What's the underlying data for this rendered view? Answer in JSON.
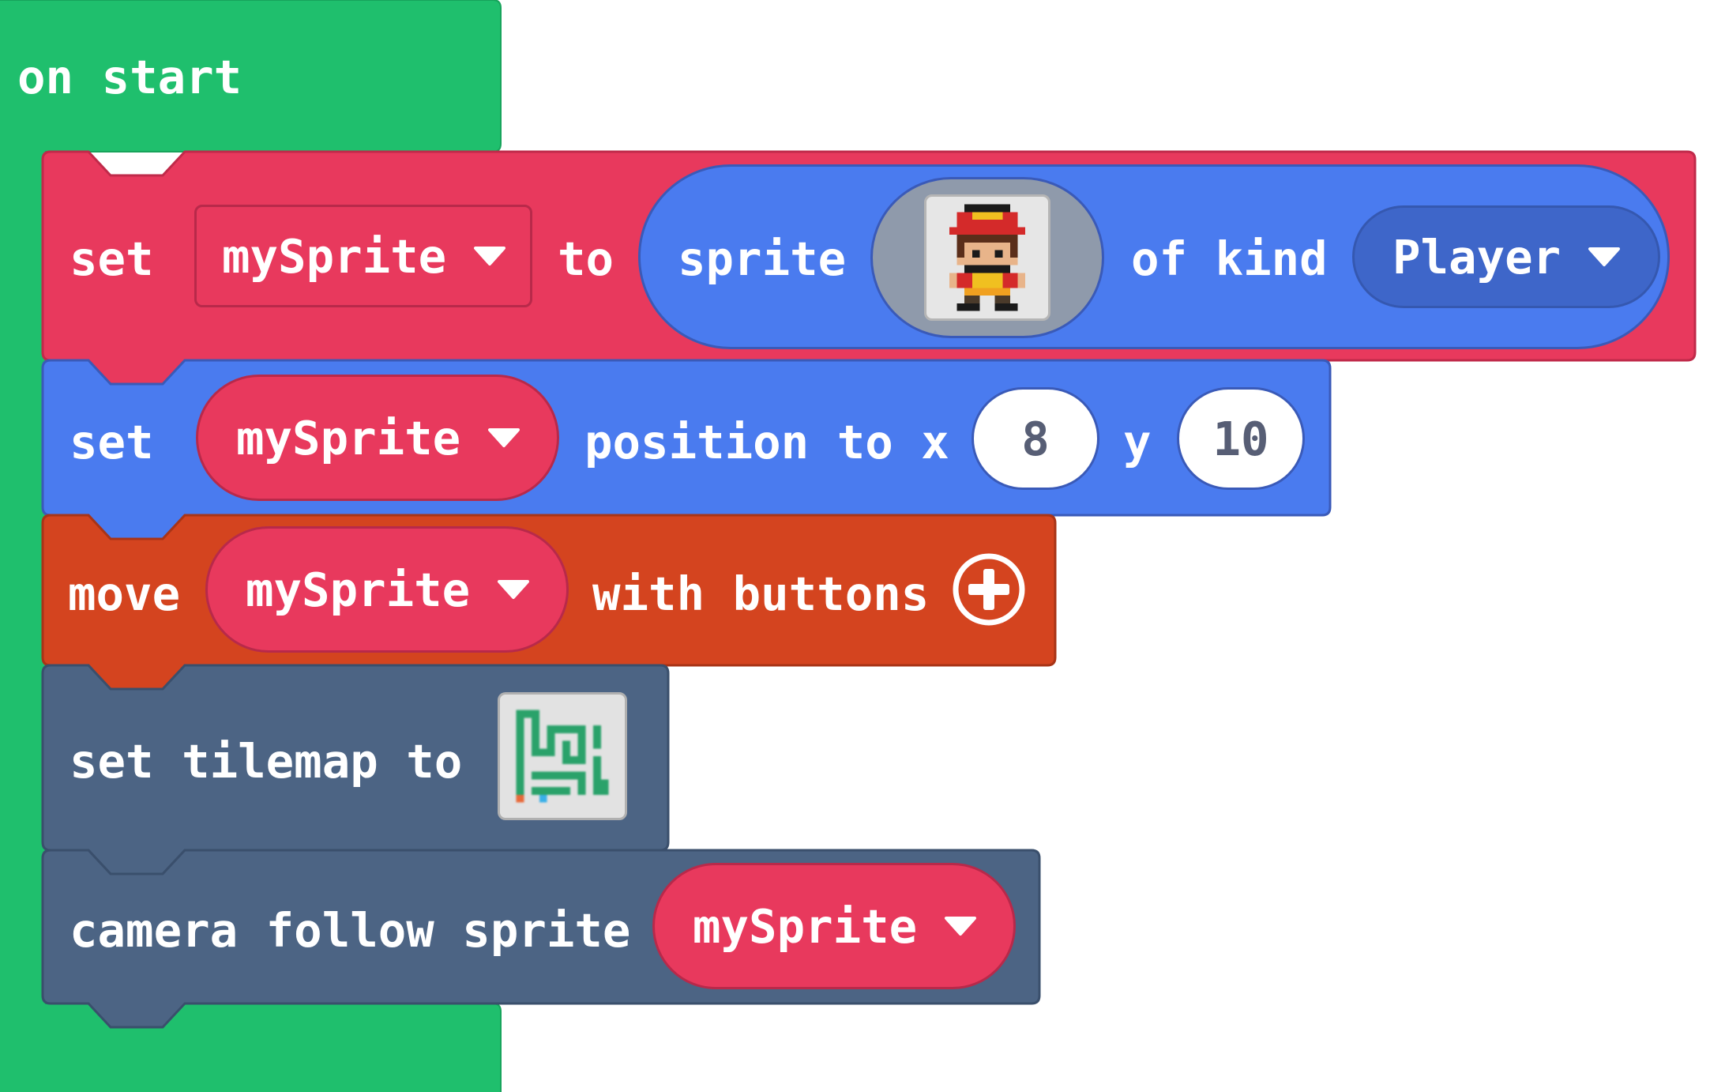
{
  "event": {
    "label": "on start",
    "color": "#1fbf6d"
  },
  "blocks": {
    "set_sprite": {
      "set_label": "set",
      "variable": "mySprite",
      "to_label": "to",
      "sprite_label": "sprite",
      "image_icon": "pixel-character-icon",
      "of_kind_label": "of kind",
      "kind": "Player",
      "color": "#e8395d",
      "inner_color": "#4a7bef",
      "kind_color": "#3e66c9"
    },
    "set_position": {
      "set_label": "set",
      "variable": "mySprite",
      "position_label": "position to x",
      "x_value": "8",
      "y_label": "y",
      "y_value": "10",
      "color": "#4a7bef"
    },
    "move_sprite": {
      "move_label": "move",
      "variable": "mySprite",
      "with_buttons_label": "with buttons",
      "expand_icon": "plus-circle-icon",
      "color": "#d4441f"
    },
    "set_tilemap": {
      "label": "set tilemap to",
      "tilemap_icon": "tilemap-thumbnail-icon",
      "color": "#4c6484"
    },
    "camera_follow": {
      "label": "camera follow sprite",
      "variable": "mySprite",
      "color": "#4c6484"
    }
  }
}
